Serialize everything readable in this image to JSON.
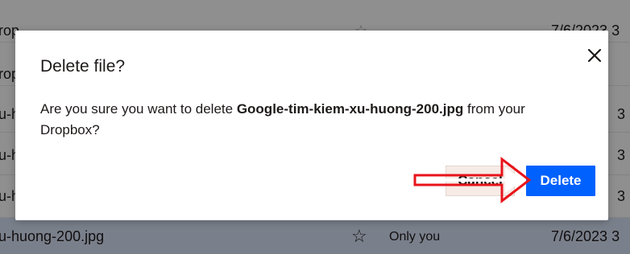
{
  "background": {
    "rows": [
      {
        "name": "rop",
        "date": "7/6/2023 3"
      },
      {
        "name": "rop",
        "date": ""
      },
      {
        "name": "u-h",
        "date": "3"
      },
      {
        "name": "u-h",
        "date": "3"
      },
      {
        "name": "u-h",
        "date": "3"
      },
      {
        "name": "u-huong-200.jpg",
        "sharing": "Only you",
        "date": "7/6/2023 3"
      }
    ]
  },
  "dialog": {
    "title": "Delete file?",
    "body_prefix": "Are you sure you want to delete ",
    "file_name": "Google-tim-kiem-xu-huong-200.jpg",
    "body_suffix": " from your Dropbox?",
    "cancel_label": "Cancel",
    "delete_label": "Delete"
  },
  "colors": {
    "primary": "#0061fe",
    "annotation_arrow": "#e8141b"
  },
  "icons": {
    "close": "close-icon",
    "star": "star-icon"
  }
}
